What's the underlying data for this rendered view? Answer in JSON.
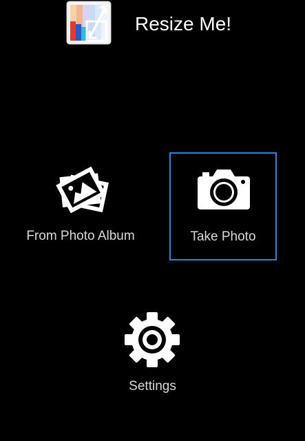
{
  "app": {
    "title": "Resize Me!",
    "logo_icon": "resize-app-logo-icon"
  },
  "actions": {
    "album": {
      "label": "From Photo Album",
      "icon": "photo-stack-icon"
    },
    "camera": {
      "label": "Take Photo",
      "icon": "camera-icon",
      "focused": true
    },
    "settings": {
      "label": "Settings",
      "icon": "gear-icon"
    }
  },
  "colors": {
    "background": "#000000",
    "focus_border": "#1e88e5",
    "label_text": "#d9d9d9",
    "title_text": "#ffffff"
  }
}
